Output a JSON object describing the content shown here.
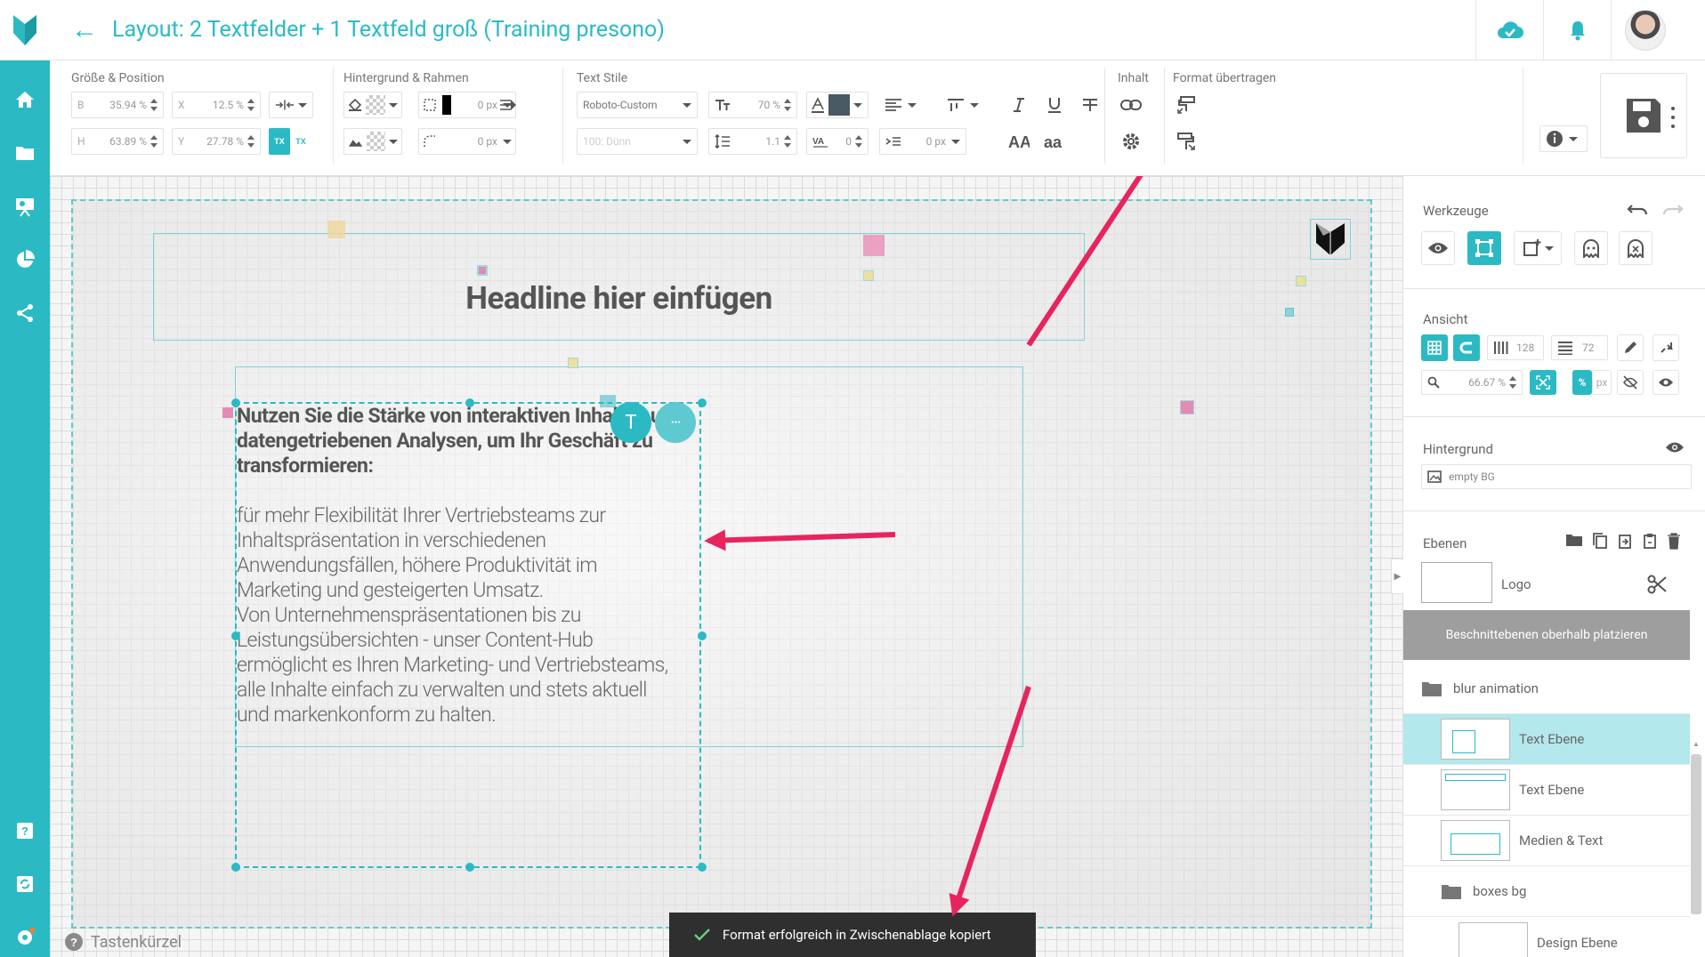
{
  "header": {
    "title": "Layout: 2 Textfelder + 1 Textfeld groß (Training presono)"
  },
  "toolbar": {
    "size_position": {
      "title": "Größe & Position",
      "b_label": "B",
      "b_value": "35.94 %",
      "x_label": "X",
      "x_value": "12.5 %",
      "h_label": "H",
      "h_value": "63.89 %",
      "y_label": "Y",
      "y_value": "27.78 %"
    },
    "background_frame": {
      "title": "Hintergrund & Rahmen",
      "border_width": "0 px",
      "radius": "0 px"
    },
    "text_styles": {
      "title": "Text Stile",
      "font": "Roboto-Custom",
      "weight": "100: Dünn",
      "size": "70 %",
      "line_height": "1.1",
      "letter_spacing": "0",
      "indent": "0 px",
      "text_color": "#4a5a63"
    },
    "content": {
      "title": "Inhalt"
    },
    "format_transfer": {
      "title": "Format übertragen"
    }
  },
  "canvas": {
    "headline": "Headline hier einfügen",
    "text_bold": "Nutzen Sie die Stärke von interaktiven Inhalten und datengetriebenen Analysen, um Ihr Geschäft zu transformieren:",
    "text_body": "für mehr Flexibilität Ihrer Vertriebsteams zur\nInhaltspräsentation in verschiedenen\nAnwendungsfällen, höhere Produktivität im\nMarketing und gesteigerten Umsatz.\nVon Unternehmenspräsentationen bis zu\nLeistungsübersichten - unser Content-Hub\nermöglicht es Ihren Marketing- und Vertriebsteams,\nalle Inhalte einfach zu verwalten und stets aktuell\nund markenkonform zu halten.",
    "text_tool_label": "T",
    "more_label": "···",
    "shortcut_label": "Tastenkürzel",
    "toast": "Format erfolgreich in Zwischenablage kopiert"
  },
  "right_panel": {
    "tools": {
      "title": "Werkzeuge"
    },
    "view": {
      "title": "Ansicht",
      "columns": "128",
      "rows": "72",
      "zoom": "66.67 %",
      "unit_percent": "%",
      "unit_px": "px"
    },
    "background": {
      "title": "Hintergrund",
      "value": "empty BG"
    },
    "layers": {
      "title": "Ebenen",
      "logo_label": "Logo",
      "clip_button": "Beschnittebenen oberhalb platzieren",
      "items": [
        {
          "label": "blur animation",
          "type": "folder"
        },
        {
          "label": "Text Ebene",
          "type": "layer",
          "selected": true
        },
        {
          "label": "Text Ebene",
          "type": "layer"
        },
        {
          "label": "Medien & Text",
          "type": "layer"
        },
        {
          "label": "boxes bg",
          "type": "folder"
        },
        {
          "label": "Design Ebene",
          "type": "layer"
        }
      ]
    }
  },
  "colors": {
    "accent": "#2bbac4",
    "arrow": "#e8245f",
    "toast_bg": "#2f2f2f",
    "clip_button_bg": "#9e9e9e",
    "selected_layer_bg": "#b3e8ec"
  }
}
